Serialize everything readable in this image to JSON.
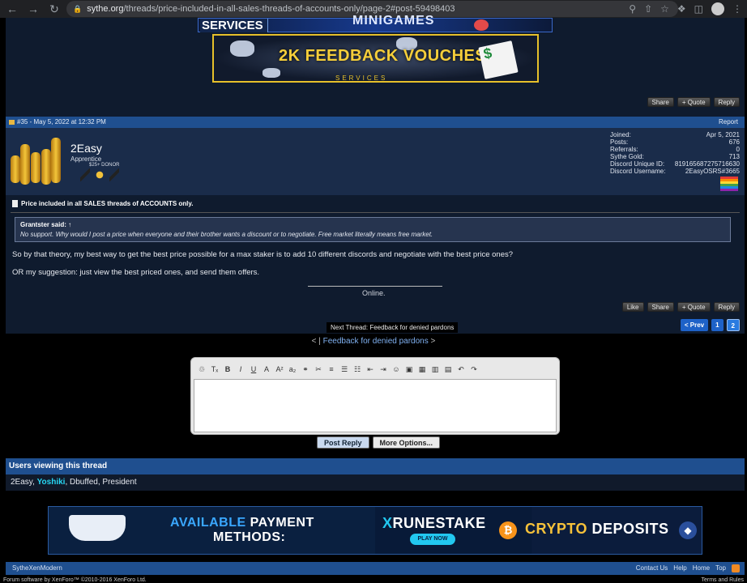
{
  "browser": {
    "url_host": "sythe.org",
    "url_path": "/threads/price-included-in-all-sales-threads-of-accounts-only/page-2#post-59498403"
  },
  "banners": {
    "top_left": "SERVICES",
    "top_mid": "MINIGAMES",
    "main_text": "2K FEEDBACK VOUCHES",
    "main_sub": "SERVICES"
  },
  "post_actions_top": {
    "share": "Share",
    "quote": "+ Quote",
    "reply": "Reply"
  },
  "post": {
    "number_date": "#35 - May 5, 2022 at 12:32 PM",
    "report": "Report",
    "username": "2Easy",
    "user_title": "Apprentice",
    "badge": "$25+ DONOR",
    "stats": [
      {
        "label": "Joined:",
        "value": "Apr 5, 2021"
      },
      {
        "label": "Posts:",
        "value": "676"
      },
      {
        "label": "Referrals:",
        "value": "0"
      },
      {
        "label": "Sythe Gold:",
        "value": "713"
      },
      {
        "label": "Discord Unique ID:",
        "value": "819165687275716630"
      },
      {
        "label": "Discord Username:",
        "value": "2EasyOSRS#3665"
      }
    ],
    "thread_title": "Price included in all SALES threads of ACCOUNTS only.",
    "quote_author": "Grantster said: ↑",
    "quote_text": "No support. Why would I post a price when everyone and their brother wants a discount or to negotiate. Free market literally means free market.",
    "body_1": "So by that theory, my best way to get the best price possible for a max staker is to add 10 different discords and negotiate with the best price ones?",
    "body_2": "OR my suggestion: just view the best priced ones, and send them offers.",
    "signature": "Online."
  },
  "post_actions_bottom": {
    "like": "Like",
    "share": "Share",
    "quote": "+ Quote",
    "reply": "Reply"
  },
  "next_thread": "Next Thread: Feedback for denied pardons",
  "pager": {
    "prev": "< Prev",
    "p1": "1",
    "p2": "2"
  },
  "prev_next_nav": {
    "left": "< |",
    "link": "Feedback for denied pardons",
    "right": ">"
  },
  "editor": {
    "toolbar": [
      "♲",
      "Tₓ",
      "B",
      "I",
      "U",
      "A",
      "A²",
      "a₂",
      "⚭",
      "✂",
      "≡",
      "☰",
      "☷",
      "⇤",
      "⇥",
      "☺",
      "▣",
      "▦",
      "▥",
      "▤",
      "↶",
      "↷"
    ],
    "post_reply": "Post Reply",
    "more_options": "More Options..."
  },
  "viewers": {
    "heading": "Users viewing this thread",
    "user1": "2Easy",
    "user2": "Yoshiki",
    "rest": ", Dbuffed, President"
  },
  "ad": {
    "available": "AVAILABLE",
    "payment": "PAYMENT",
    "methods": "METHODS:",
    "rune_x": "X",
    "rune": "RUNESTAKE",
    "play_now": "PLAY NOW",
    "crypto": "CRYPTO",
    "deposits": "DEPOSITS"
  },
  "footer": {
    "style": "SytheXenModern",
    "links": [
      "Contact Us",
      "Help",
      "Home",
      "Top"
    ],
    "copyright": "Forum software by XenForo™ ©2010-2016 XenForo Ltd.",
    "terms": "Terms and Rules"
  },
  "colors": {
    "accent": "#1f4f8f",
    "highlight_user": "#27d7f4",
    "bg": "#0f1b2e"
  }
}
